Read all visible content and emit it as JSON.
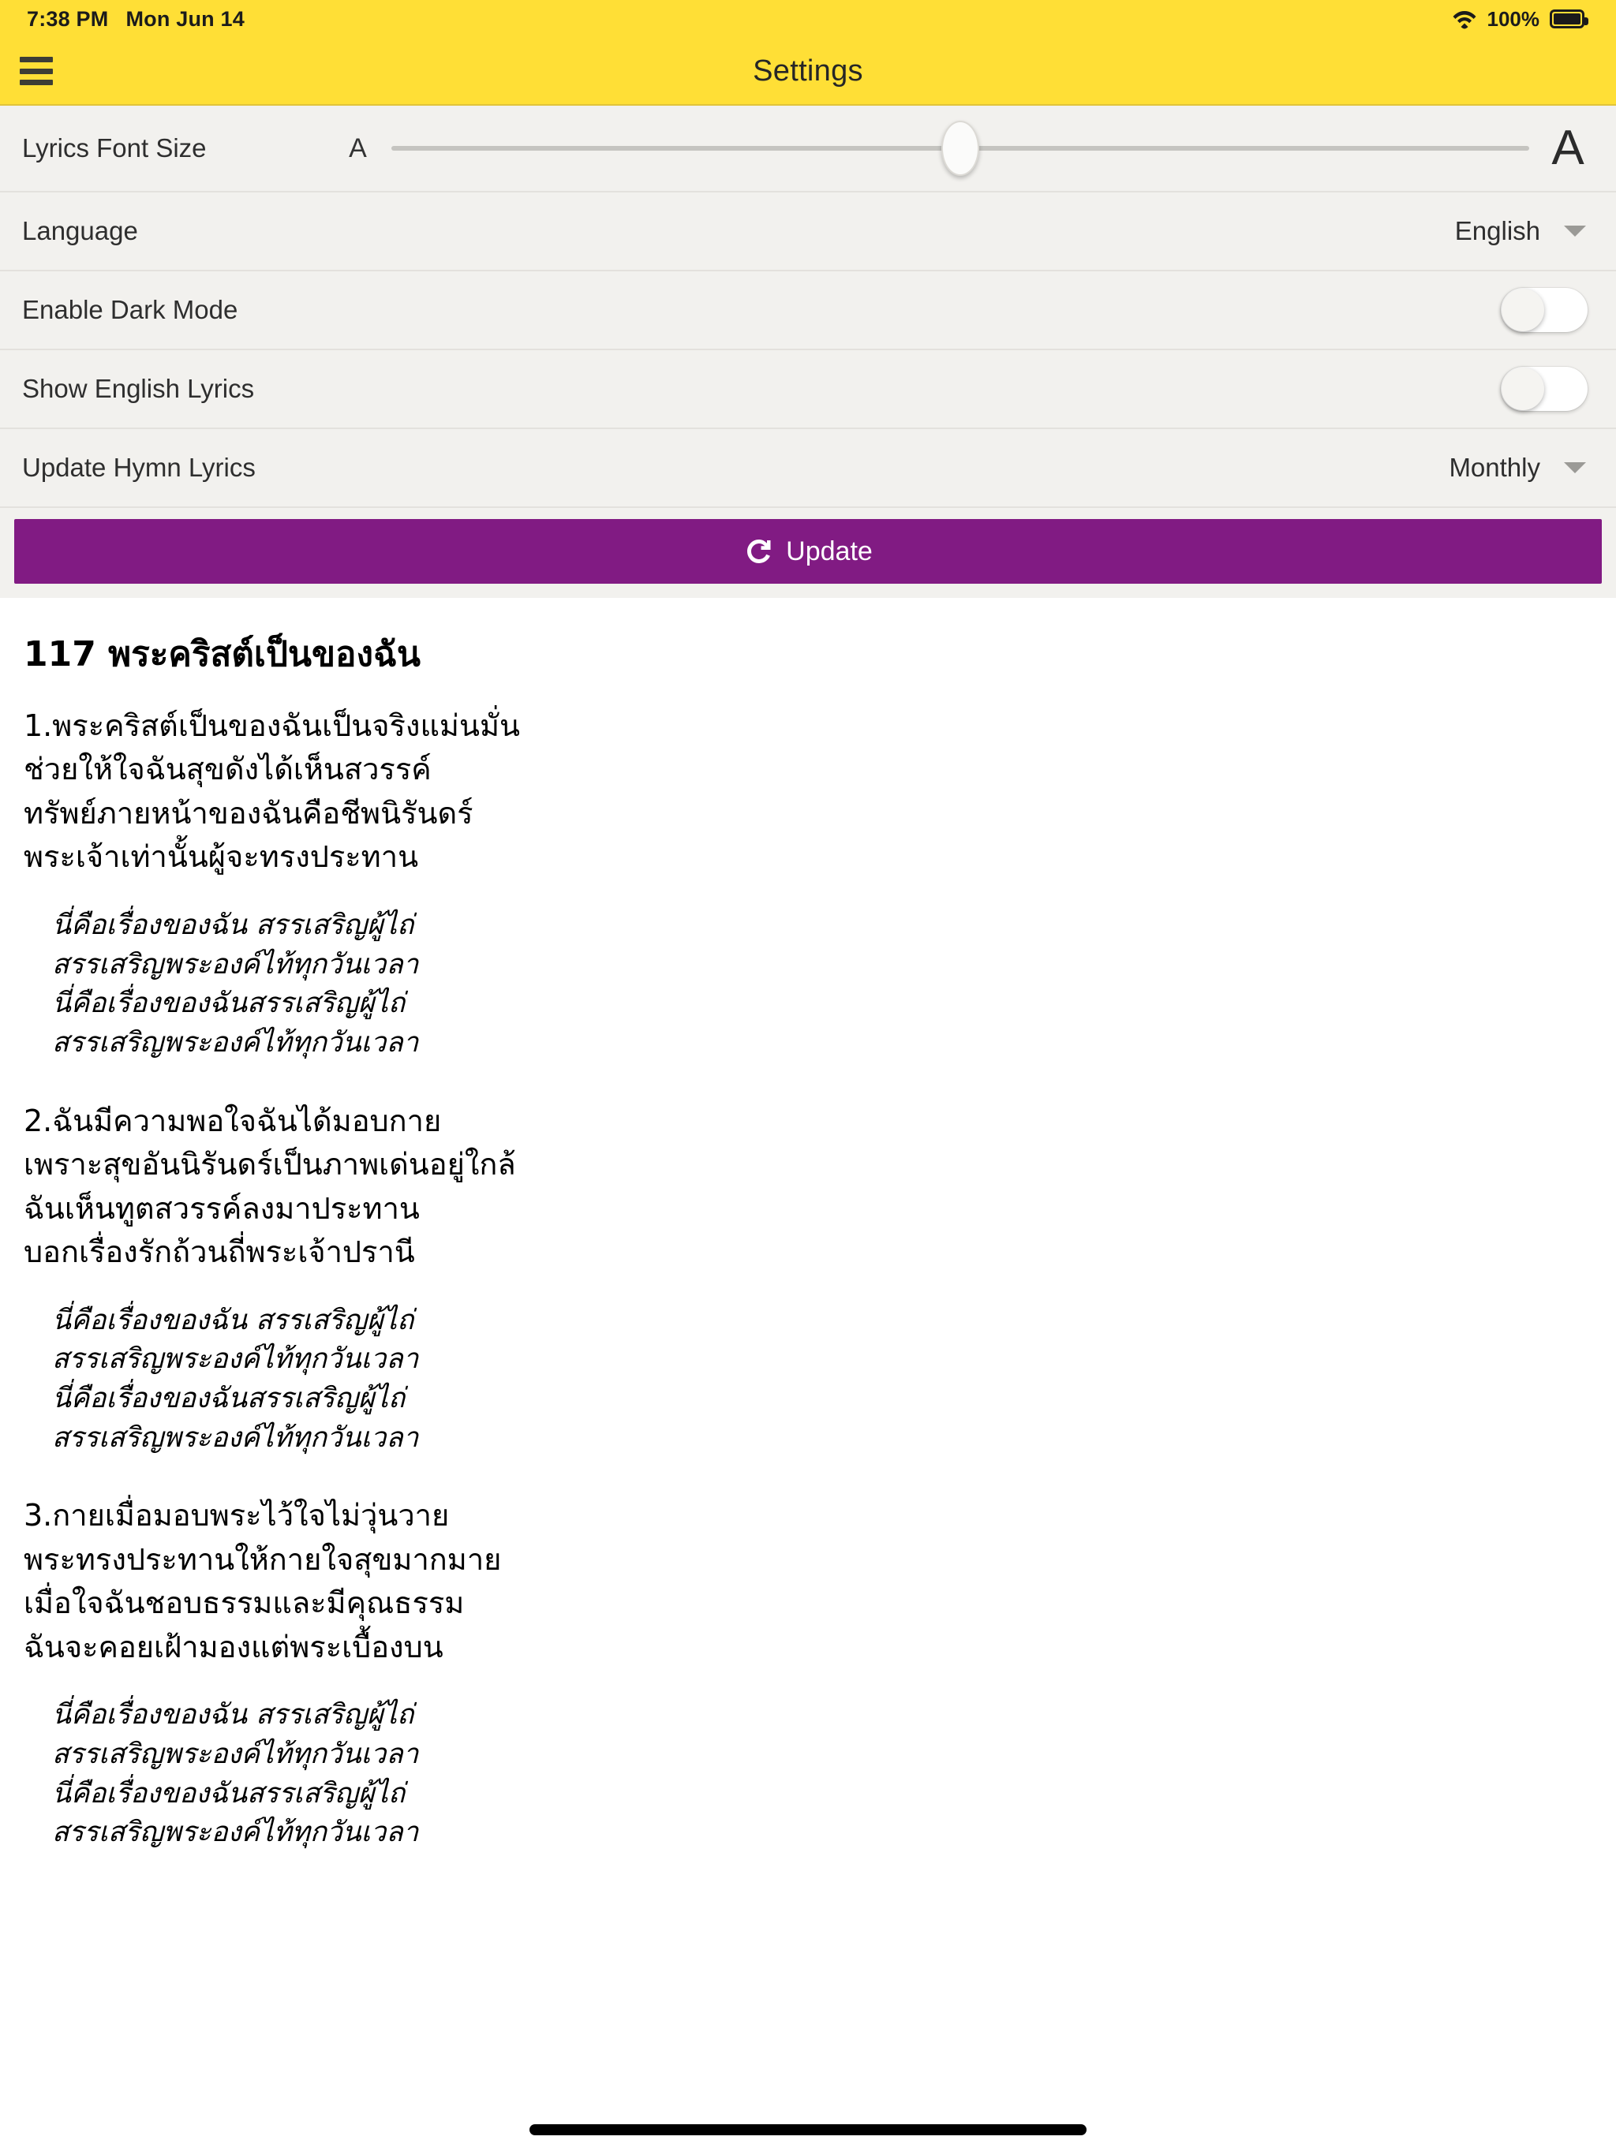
{
  "status_bar": {
    "time": "7:38 PM",
    "date": "Mon Jun 14",
    "wifi_icon": "wifi-icon",
    "battery_percent": "100%",
    "battery_icon": "battery-full-icon"
  },
  "app_bar": {
    "menu_icon": "hamburger-menu-icon",
    "title": "Settings",
    "background_color": "#ffdf36"
  },
  "settings": {
    "font_size": {
      "label": "Lyrics Font Size",
      "min_label": "A",
      "max_label": "A",
      "value_percent": 50
    },
    "language": {
      "label": "Language",
      "value": "English",
      "caret_icon": "chevron-down-icon"
    },
    "dark_mode": {
      "label": "Enable Dark Mode",
      "state": "off"
    },
    "english_lyrics": {
      "label": "Show English Lyrics",
      "state": "off"
    },
    "update_frequency": {
      "label": "Update Hymn Lyrics",
      "value": "Monthly",
      "caret_icon": "chevron-down-icon"
    },
    "update_button": {
      "label": "Update",
      "icon": "refresh-icon",
      "color": "#811b83"
    }
  },
  "hymn": {
    "title": "117 พระคริสต์เป็นของฉัน",
    "verse1": "1.พระคริสต์เป็นของฉันเป็นจริงแม่นมั่น\nช่วยให้ใจฉันสุขดังได้เห็นสวรรค์\nทรัพย์ภายหน้าของฉันคือชีพนิรันดร์\nพระเจ้าเท่านั้นผู้จะทรงประทาน",
    "chorus1": "นี่คือเรื่องของฉัน สรรเสริญผู้ไถ่\nสรรเสริญพระองค์ไท้ทุกวันเวลา\nนี่คือเรื่องของฉันสรรเสริญผู้ไถ่\nสรรเสริญพระองค์ไท้ทุกวันเวลา",
    "verse2": "2.ฉันมีความพอใจฉันได้มอบกาย\nเพราะสุขอันนิรันดร์เป็นภาพเด่นอยู่ใกล้\nฉันเห็นทูตสวรรค์ลงมาประทาน\nบอกเรื่องรักถ้วนถี่พระเจ้าปรานี",
    "chorus2": "นี่คือเรื่องของฉัน สรรเสริญผู้ไถ่\nสรรเสริญพระองค์ไท้ทุกวันเวลา\nนี่คือเรื่องของฉันสรรเสริญผู้ไถ่\nสรรเสริญพระองค์ไท้ทุกวันเวลา",
    "verse3": "3.กายเมื่อมอบพระไว้ใจไม่วุ่นวาย\nพระทรงประทานให้กายใจสุขมากมาย\nเมื่อใจฉันชอบธรรมและมีคุณธรรม\nฉันจะคอยเฝ้ามองแต่พระเบื้องบน",
    "chorus3": "นี่คือเรื่องของฉัน สรรเสริญผู้ไถ่\nสรรเสริญพระองค์ไท้ทุกวันเวลา\nนี่คือเรื่องของฉันสรรเสริญผู้ไถ่\nสรรเสริญพระองค์ไท้ทุกวันเวลา"
  },
  "home_indicator": "home-indicator"
}
